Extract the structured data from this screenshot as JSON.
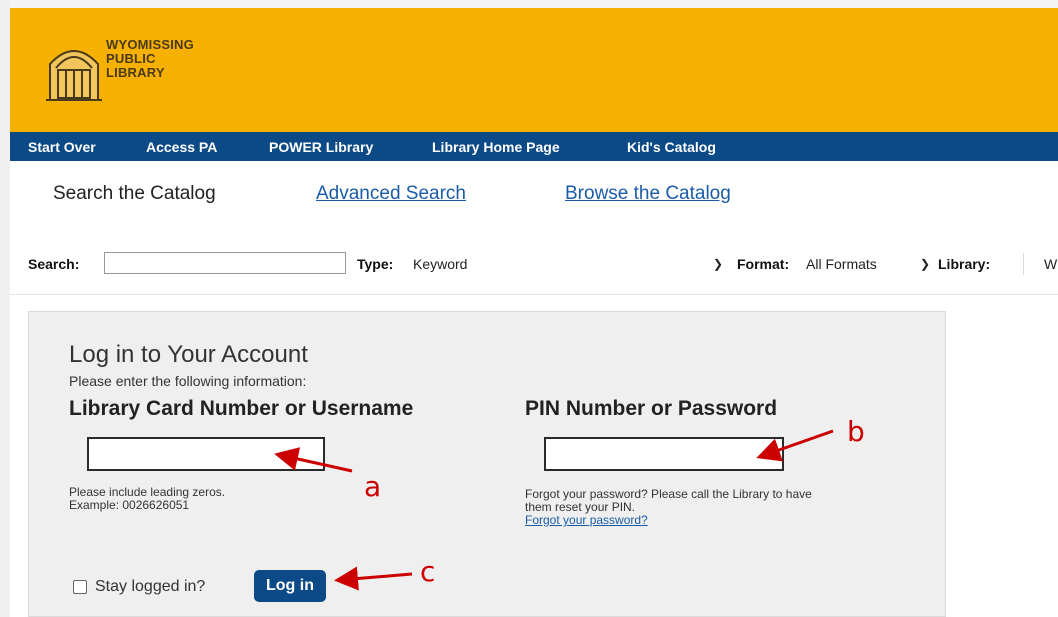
{
  "header": {
    "logo_lines": [
      "WYOMISSING",
      "PUBLIC",
      "LIBRARY"
    ],
    "bg_color": "#f6b000"
  },
  "nav": {
    "items": [
      "Start Over",
      "Access PA",
      "POWER Library",
      "Library Home Page",
      "Kid's Catalog"
    ],
    "bg_color": "#0b4a86"
  },
  "tabs": {
    "active": "Search the Catalog",
    "advanced": "Advanced Search",
    "browse": "Browse the Catalog"
  },
  "search": {
    "search_label": "Search:",
    "search_value": "",
    "type_label": "Type:",
    "type_value": "Keyword",
    "format_label": "Format:",
    "format_value": "All Formats",
    "library_label": "Library:",
    "library_value": "W"
  },
  "login": {
    "title": "Log in to Your Account",
    "subtitle": "Please enter the following information:",
    "card_label": "Library Card Number or Username",
    "card_value": "",
    "card_help": [
      "Please include leading zeros.",
      "Example: 0026626051"
    ],
    "pin_label": "PIN Number or Password",
    "pin_value": "",
    "pin_help": [
      "Forgot your password? Please call the Library to have",
      "them reset your PIN."
    ],
    "forgot_link": "Forgot your password?",
    "stay_label": "Stay logged in?",
    "login_button": "Log in"
  },
  "annotations": {
    "a": "a",
    "b": "b",
    "c": "c",
    "color": "#cc0000"
  }
}
